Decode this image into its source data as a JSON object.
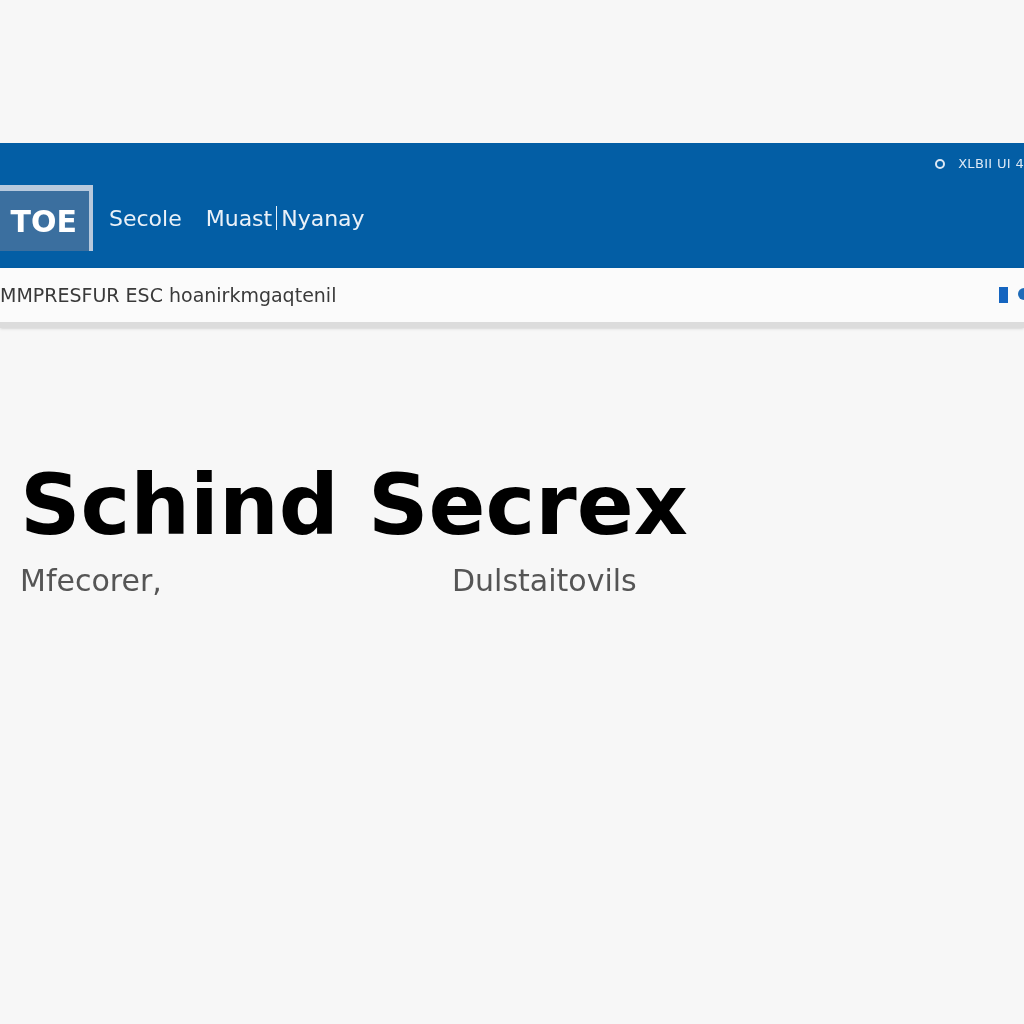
{
  "header": {
    "logo": "TOE",
    "nav": [
      {
        "label": "Secole"
      },
      {
        "label": "Muast"
      },
      {
        "label": "Nyanay"
      }
    ],
    "top_links": "XLBII UI 4"
  },
  "breadcrumb_bar": {
    "text": "MMPRESFUR ESC hoanirkmgaqtenil"
  },
  "hero": {
    "title": "Schind Secrex",
    "subtitle_left": "Mfecorer,",
    "subtitle_right": "Dulstaitovils"
  }
}
